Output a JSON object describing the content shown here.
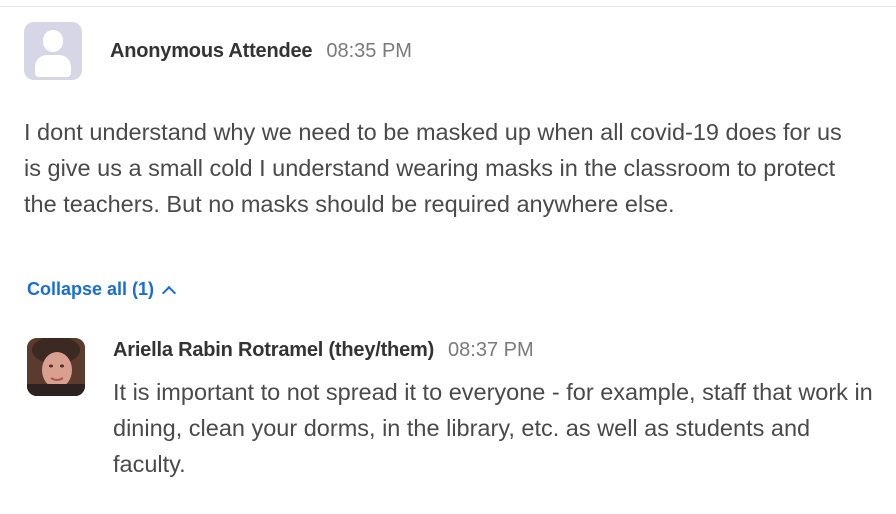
{
  "question": {
    "author": "Anonymous Attendee",
    "time": "08:35 PM",
    "avatar_icon": "person-placeholder-icon",
    "text": "I dont understand why we need to be masked up when all covid-19 does for us is give us a small cold I understand wearing masks in the classroom to protect the teachers. But no masks should be required anywhere else."
  },
  "collapse": {
    "label": "Collapse all (1)",
    "icon": "chevron-up-icon",
    "color": "#1a6dd8"
  },
  "reply": {
    "author": "Ariella Rabin Rotramel (they/them)",
    "time": "08:37 PM",
    "text": "It is important to not spread it to everyone - for example, staff that work in dining, clean your dorms, in the library, etc. as well as students and faculty."
  }
}
